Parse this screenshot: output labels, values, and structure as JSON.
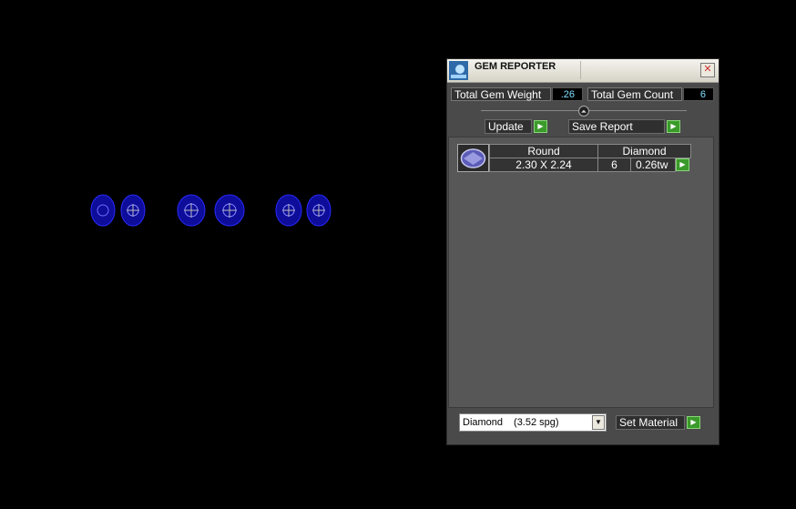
{
  "window": {
    "title": "GEM REPORTER",
    "close_glyph": "✕"
  },
  "summary": {
    "total_weight_label": "Total Gem Weight",
    "total_weight_value": ".26",
    "total_count_label": "Total Gem Count",
    "total_count_value": "6"
  },
  "slider": {
    "knob_glyph": "⏶"
  },
  "buttons": {
    "update_label": "Update",
    "save_report_label": "Save Report",
    "set_material_label": "Set Material",
    "go_glyph": "▶"
  },
  "report": {
    "rows": [
      {
        "shape": "Round",
        "material": "Diamond",
        "size": "2.30 X 2.24",
        "count": "6",
        "weight": "0.26tw"
      }
    ]
  },
  "material_select": {
    "name": "Diamond",
    "spg": "(3.52 spg)",
    "arrow_glyph": "▼"
  },
  "colors": {
    "gem_blue": "#1a1ab8",
    "go_green": "#3a9a2a",
    "value_cyan": "#7fe0ff"
  },
  "viewport": {
    "gem_count": 6
  }
}
